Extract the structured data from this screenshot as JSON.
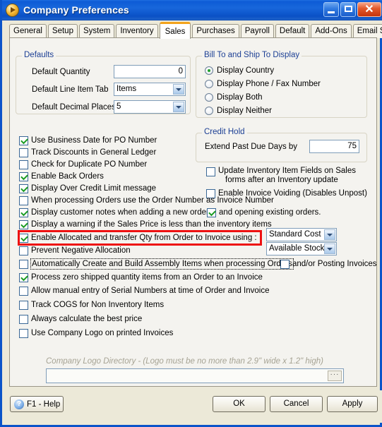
{
  "window": {
    "title": "Company Preferences",
    "icon": "play-circle-icon",
    "buttons": {
      "minimize": "_",
      "maximize": "□",
      "close": "✕"
    }
  },
  "tabs": [
    {
      "label": "General",
      "active": false
    },
    {
      "label": "Setup",
      "active": false
    },
    {
      "label": "System",
      "active": false
    },
    {
      "label": "Inventory",
      "active": false
    },
    {
      "label": "Sales",
      "active": true
    },
    {
      "label": "Purchases",
      "active": false
    },
    {
      "label": "Payroll",
      "active": false
    },
    {
      "label": "Default",
      "active": false
    },
    {
      "label": "Add-Ons",
      "active": false
    },
    {
      "label": "Email Setup",
      "active": false
    }
  ],
  "defaults_group": {
    "title": "Defaults",
    "quantity_label": "Default Quantity",
    "quantity_value": "0",
    "line_item_tab_label": "Default Line Item Tab",
    "line_item_tab_value": "Items",
    "decimal_places_label": "Default Decimal Places",
    "decimal_places_value": "5"
  },
  "billship_group": {
    "title": "Bill To and Ship To Display",
    "options": [
      {
        "label": "Display Country",
        "selected": true
      },
      {
        "label": "Display Phone / Fax Number",
        "selected": false
      },
      {
        "label": "Display Both",
        "selected": false
      },
      {
        "label": "Display Neither",
        "selected": false
      }
    ]
  },
  "credit_hold_group": {
    "title": "Credit Hold",
    "extend_label": "Extend Past Due Days by",
    "extend_value": "75"
  },
  "left_checks": [
    {
      "label": "Use Business Date for PO Number",
      "checked": true
    },
    {
      "label": "Track Discounts in General Ledger",
      "checked": false
    },
    {
      "label": "Check for Duplicate PO Number",
      "checked": false
    },
    {
      "label": "Enable Back Orders",
      "checked": true
    },
    {
      "label": "Display Over Credit Limit message",
      "checked": true
    },
    {
      "label": "When processing Orders use the Order Number as Invoice Number",
      "checked": false
    },
    {
      "label": "Display customer notes when adding a new order",
      "checked": true
    },
    {
      "label": "Display a warning if the Sales Price is less than the inventory items",
      "checked": true
    },
    {
      "label": "Enable Allocated and transfer Qty from Order to Invoice using :",
      "checked": true
    },
    {
      "label": "Prevent Negative Allocation",
      "checked": false
    },
    {
      "label": "Automatically Create and Build Assembly Items when processing Orders",
      "checked": false
    },
    {
      "label": "Process zero shipped quantity items from an Order to an Invoice",
      "checked": true
    },
    {
      "label": "Allow manual entry of Serial Numbers at time of Order and Invoice",
      "checked": false
    },
    {
      "label": "Track COGS for Non Inventory Items",
      "checked": false
    },
    {
      "label": "Always calculate the best price",
      "checked": false
    },
    {
      "label": "Use Company Logo on printed Invoices",
      "checked": false
    }
  ],
  "right_checks": {
    "update_inventory_line1": "Update Inventory Item Fields on Sales",
    "update_inventory_line2": "forms after an Inventory update",
    "update_inventory_checked": false,
    "enable_voiding": "Enable Invoice Voiding (Disables Unpost)",
    "enable_voiding_checked": false,
    "opening_existing": "and opening existing orders.",
    "opening_existing_checked": true,
    "posting_invoices": "and/or Posting Invoices",
    "posting_invoices_checked": false
  },
  "allocation_combos": {
    "cost_value": "Standard Cost",
    "stock_value": "Available Stock"
  },
  "logo": {
    "hint": "Company Logo Directory - (Logo must be no more than 2.9\" wide x 1.2\" high)",
    "value": "",
    "browse_label": "···"
  },
  "footer": {
    "help": "F1 - Help",
    "help_icon": "?",
    "ok": "OK",
    "cancel": "Cancel",
    "apply": "Apply"
  },
  "accents": {
    "title_blue": "#0d5bd6",
    "active_tab_orange": "#f2a31b",
    "group_title_blue": "#1c3f94",
    "highlight_red": "#ee1111",
    "check_green": "#1a9b22"
  }
}
